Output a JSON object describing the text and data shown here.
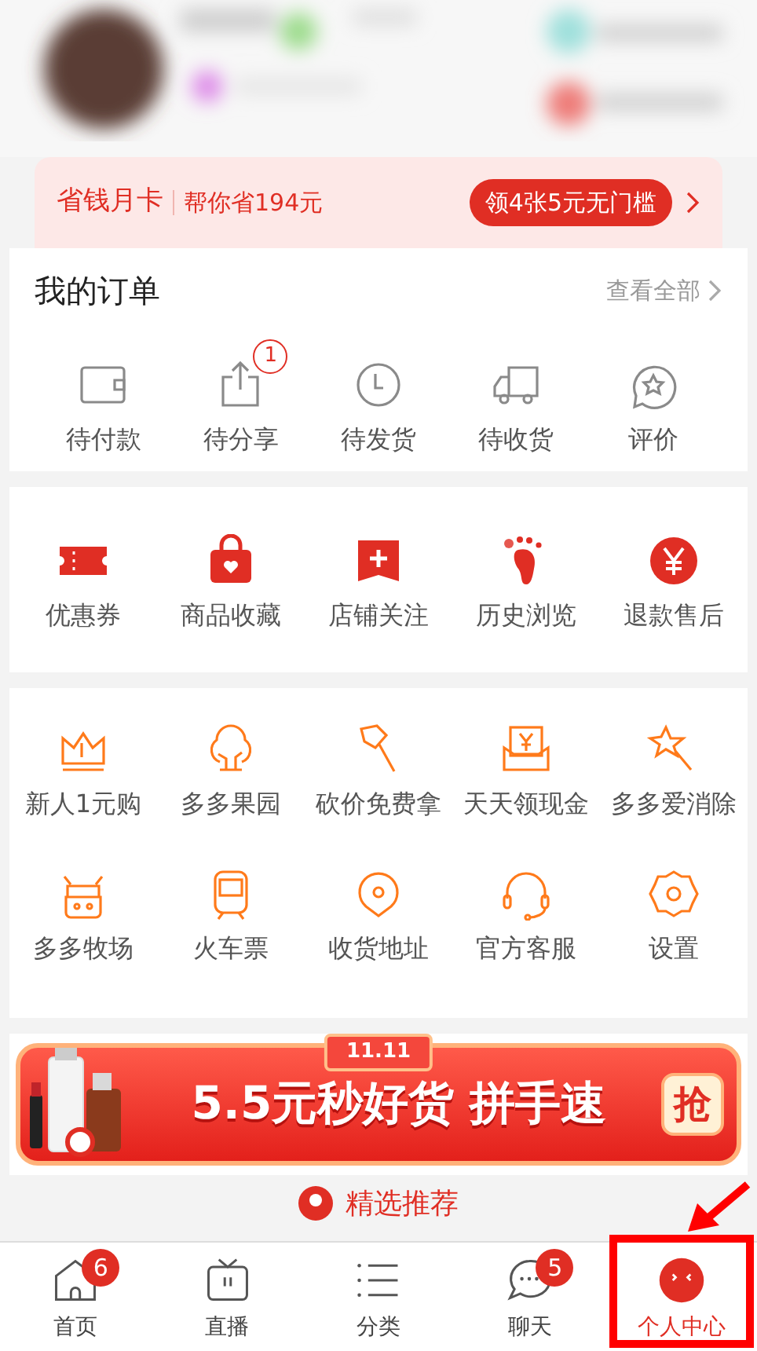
{
  "monthly_card": {
    "title": "省钱月卡",
    "subtitle": "帮你省194元",
    "button": "领4张5元无门槛"
  },
  "orders": {
    "title": "我的订单",
    "view_all": "查看全部",
    "items": [
      {
        "label": "待付款"
      },
      {
        "label": "待分享",
        "badge": "1"
      },
      {
        "label": "待发货"
      },
      {
        "label": "待收货"
      },
      {
        "label": "评价"
      }
    ]
  },
  "services": [
    {
      "label": "优惠券"
    },
    {
      "label": "商品收藏"
    },
    {
      "label": "店铺关注"
    },
    {
      "label": "历史浏览"
    },
    {
      "label": "退款售后"
    }
  ],
  "tools": [
    {
      "label": "新人1元购"
    },
    {
      "label": "多多果园"
    },
    {
      "label": "砍价免费拿"
    },
    {
      "label": "天天领现金"
    },
    {
      "label": "多多爱消除"
    },
    {
      "label": "多多牧场"
    },
    {
      "label": "火车票"
    },
    {
      "label": "收货地址"
    },
    {
      "label": "官方客服"
    },
    {
      "label": "设置"
    }
  ],
  "banner": {
    "tag": "11.11",
    "headline": "5.5元秒好货 拼手速",
    "button": "抢"
  },
  "recommend": {
    "title": "精选推荐"
  },
  "tabbar": [
    {
      "label": "首页",
      "badge": "6",
      "selected": false
    },
    {
      "label": "直播",
      "selected": false
    },
    {
      "label": "分类",
      "selected": false
    },
    {
      "label": "聊天",
      "badge": "5",
      "selected": false
    },
    {
      "label": "个人中心",
      "selected": true
    }
  ]
}
